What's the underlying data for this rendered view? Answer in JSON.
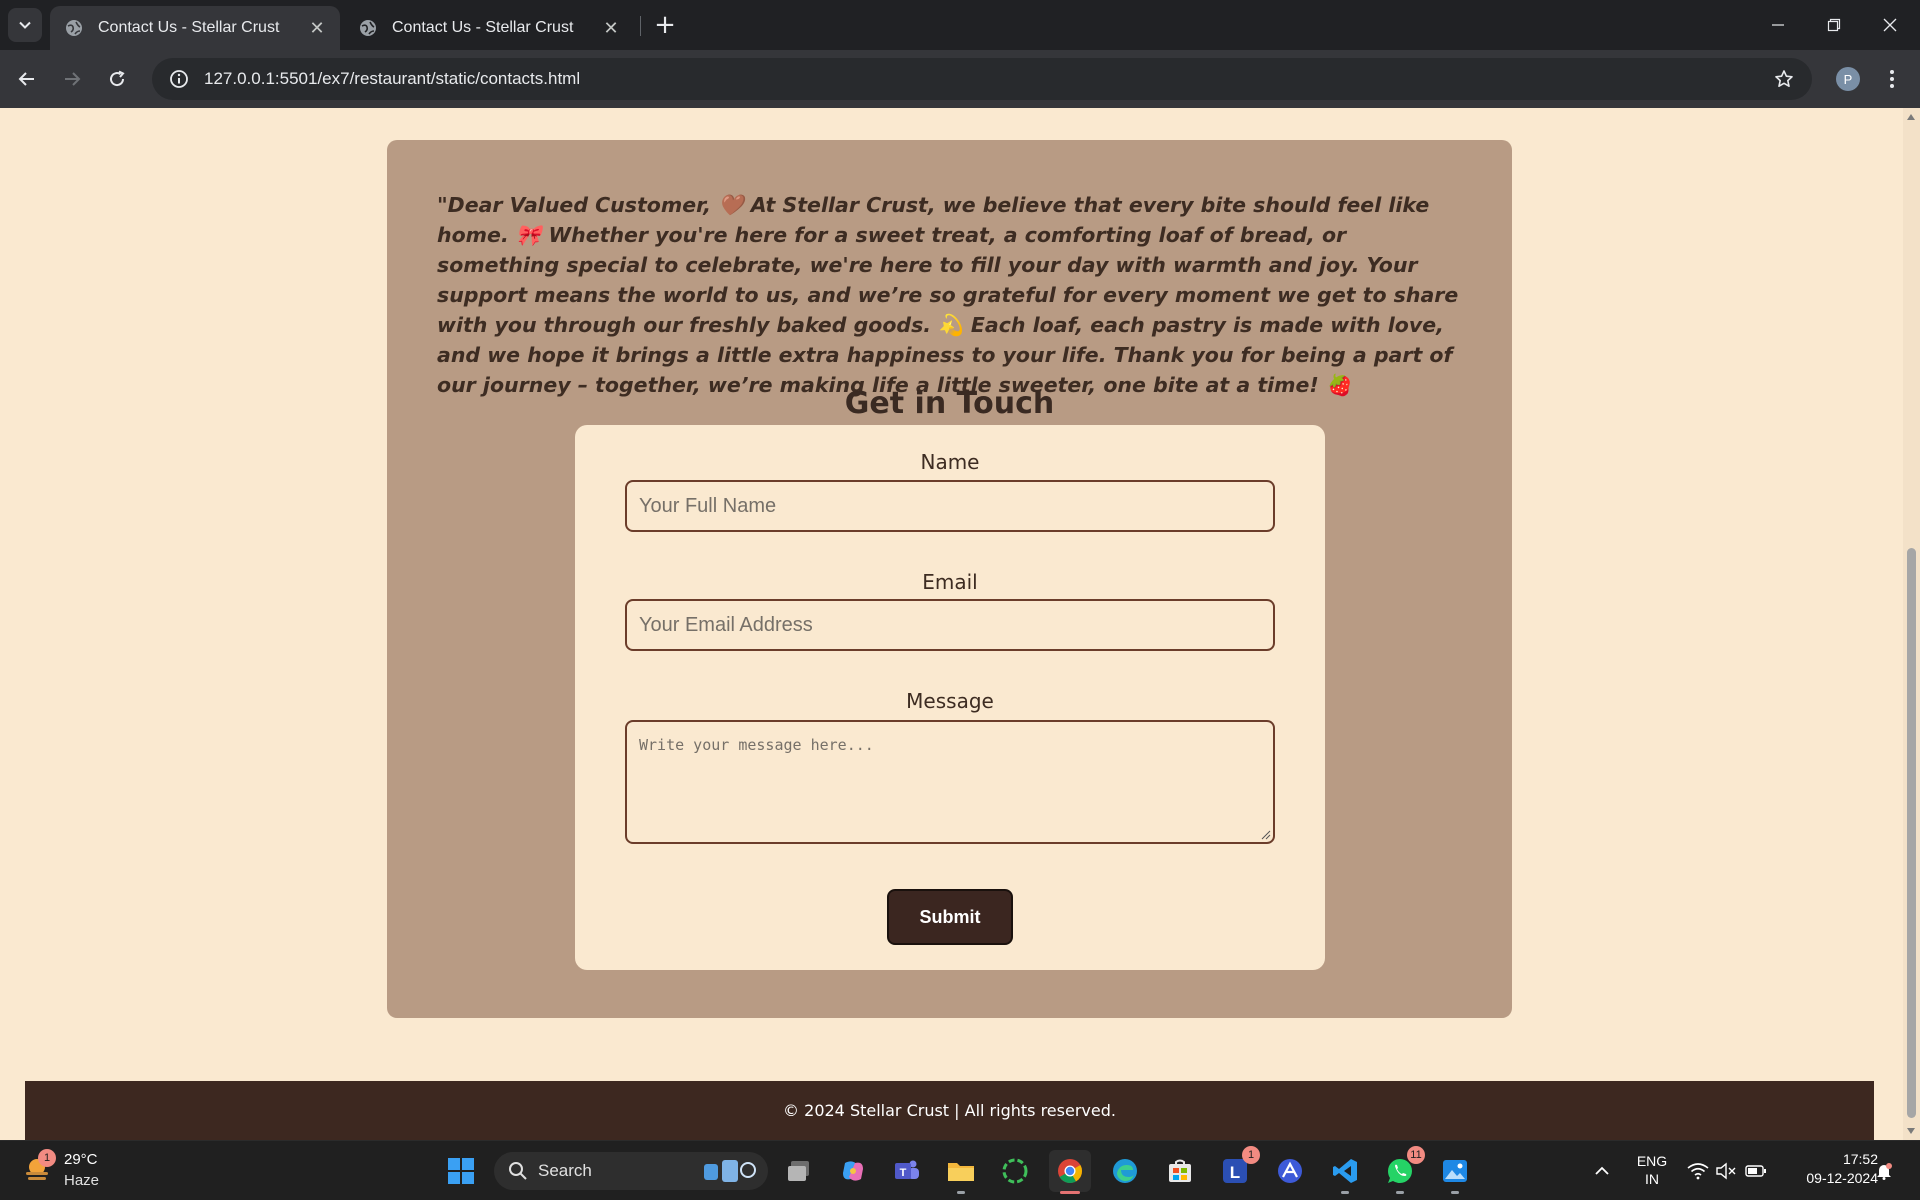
{
  "browser": {
    "tabs": [
      {
        "title": "Contact Us - Stellar Crust",
        "active": true
      },
      {
        "title": "Contact Us - Stellar Crust",
        "active": false
      }
    ],
    "url": "127.0.0.1:5501/ex7/restaurant/static/contacts.html",
    "profile_initial": "P"
  },
  "page": {
    "letter": "\"Dear Valued Customer, 🤎 At Stellar Crust, we believe that every bite should feel like home. 🎀 Whether you're here for a sweet treat, a comforting loaf of bread, or something special to celebrate, we're here to fill your day with warmth and joy. Your support means the world to us, and we’re so grateful for every moment we get to share with you through our freshly baked goods. 💫 Each loaf, each pastry is made with love, and we hope it brings a little extra happiness to your life. Thank you for being a part of our journey – together, we’re making life a little sweeter, one bite at a time! 🍓",
    "heading": "Get in Touch",
    "form": {
      "name_label": "Name",
      "name_placeholder": "Your Full Name",
      "email_label": "Email",
      "email_placeholder": "Your Email Address",
      "message_label": "Message",
      "message_placeholder": "Write your message here...",
      "submit_label": "Submit"
    },
    "footer": "© 2024 Stellar Crust | All rights reserved."
  },
  "taskbar": {
    "weather": {
      "temp": "29°C",
      "condition": "Haze",
      "badge": "1"
    },
    "search_label": "Search",
    "apps": [
      {
        "name": "start-icon"
      },
      {
        "name": "task-view-icon"
      },
      {
        "name": "copilot-icon"
      },
      {
        "name": "teams-icon"
      },
      {
        "name": "file-explorer-icon"
      },
      {
        "name": "loader-app-icon"
      },
      {
        "name": "chrome-icon"
      },
      {
        "name": "edge-icon"
      },
      {
        "name": "store-icon"
      },
      {
        "name": "l-app-icon",
        "badge": "1"
      },
      {
        "name": "a-app-icon"
      },
      {
        "name": "vscode-icon"
      },
      {
        "name": "whatsapp-icon",
        "badge": "11"
      },
      {
        "name": "photos-icon"
      }
    ],
    "language": {
      "line1": "ENG",
      "line2": "IN"
    },
    "time": "17:52",
    "date": "09-12-2024"
  },
  "colors": {
    "page_bg": "#fae9d0",
    "card_bg": "#b89b84",
    "accent_dark": "#3b2620",
    "input_border": "#6b3d2a"
  }
}
